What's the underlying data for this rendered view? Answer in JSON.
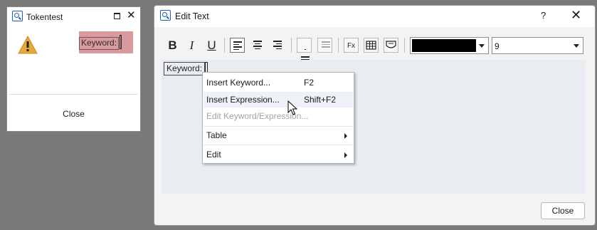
{
  "tokentest": {
    "title": "Tokentest",
    "keyword_label": "Keyword:",
    "close_label": "Close"
  },
  "dialog": {
    "title": "Edit Text",
    "help_label": "?",
    "close_x": "✕",
    "editor_keyword": "Keyword:",
    "font_size": "9",
    "text_color": "#000000",
    "close_button": "Close",
    "toolbar": {
      "bold": "B",
      "italic": "I",
      "underline": "U",
      "fx": "Fx"
    }
  },
  "context_menu": {
    "items": [
      {
        "label": "Insert Keyword...",
        "shortcut": "F2"
      },
      {
        "label": "Insert Expression...",
        "shortcut": "Shift+F2"
      },
      {
        "label": "Edit Keyword/Expression..."
      },
      {
        "label": "Table"
      },
      {
        "label": "Edit"
      }
    ]
  },
  "icons": {
    "app": "search-window-icon",
    "warning": "warning-icon",
    "maximize": "maximize-icon",
    "close": "close-icon",
    "align_left": "align-left-icon",
    "align_center": "align-center-icon",
    "align_right": "align-right-icon",
    "bullet_list": "bullet-list-icon",
    "numbered_list": "numbered-list-icon",
    "insert_expression": "fx-icon",
    "insert_table": "table-icon",
    "insert_field": "field-icon",
    "pointer": "mouse-pointer-icon"
  }
}
